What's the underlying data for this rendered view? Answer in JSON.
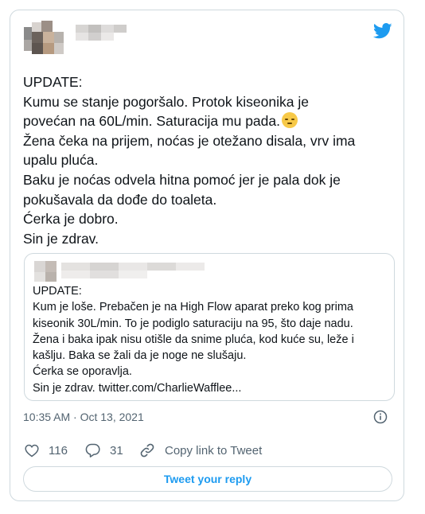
{
  "tweet": {
    "lines": [
      "UPDATE:",
      "Kumu se stanje pogoršalo. Protok kiseonika je",
      "povećan na 60L/min. Saturacija mu pada.",
      "Žena čeka na prijem, noćas je otežano disala, vrv ima",
      "upalu pluća.",
      "Baku je noćas odvela hitna pomoć jer je pala dok je",
      "pokušavala da dođe do toaleta.",
      "Ćerka je dobro.",
      "Sin je zdrav."
    ],
    "emoji": "pensive-face-emoji",
    "timestamp": "10:35 AM · Oct 13, 2021"
  },
  "quote": {
    "lines": [
      "UPDATE:",
      "Kum je loše. Prebačen je na High Flow aparat preko kog prima",
      "kiseonik 30L/min. To je podiglo saturaciju na 95, što daje nadu.",
      "Žena i baka ipak nisu otišle da snime pluća, kod kuće su, leže i",
      "kašlju. Baka se žali da je noge ne slušaju.",
      "Ćerka se oporavlja.",
      "Sin je zdrav. twitter.com/CharlieWafflee..."
    ]
  },
  "actions": {
    "like_count": "116",
    "reply_count": "31",
    "copy_link_label": "Copy link to Tweet"
  },
  "reply_button_label": "Tweet your reply",
  "colors": {
    "accent": "#1d9bf0",
    "border": "#cfd9de",
    "muted": "#536471"
  }
}
